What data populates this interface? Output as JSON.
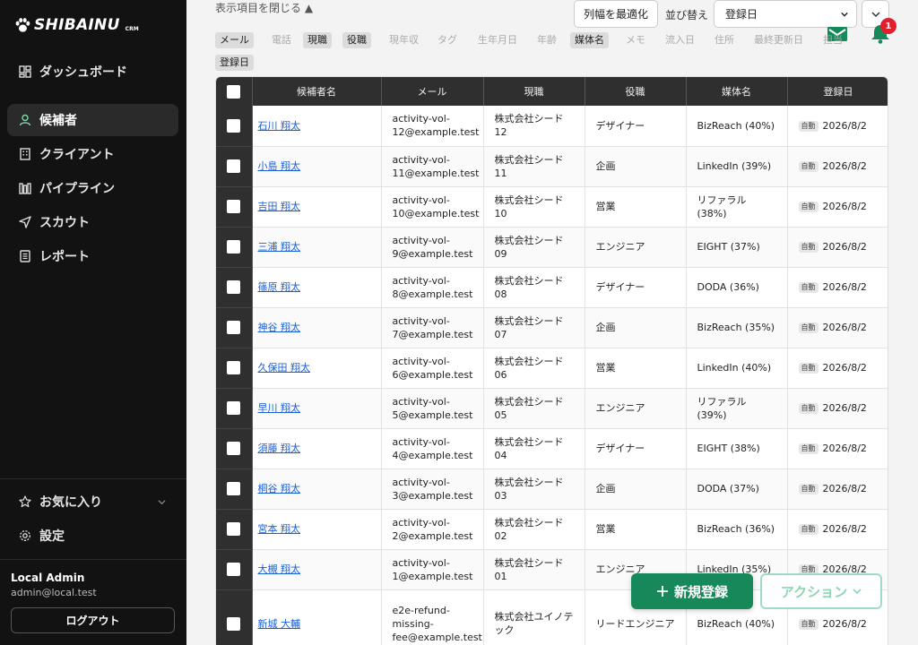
{
  "brand": {
    "name": "SHIBAINU",
    "sub": "CRM"
  },
  "sidebar": {
    "items": [
      {
        "label": "ダッシュボード",
        "icon": "dashboard-icon"
      },
      {
        "label": "候補者",
        "icon": "person-icon",
        "active": true
      },
      {
        "label": "クライアント",
        "icon": "building-icon"
      },
      {
        "label": "パイプライン",
        "icon": "pipeline-icon"
      },
      {
        "label": "スカウト",
        "icon": "send-icon"
      },
      {
        "label": "レポート",
        "icon": "report-icon"
      }
    ],
    "favorites_label": "お気に入り",
    "settings_label": "設定",
    "user": {
      "name": "Local Admin",
      "email": "admin@local.test"
    },
    "logout_label": "ログアウト"
  },
  "toolbar": {
    "collapse_label": "表示項目を閉じる ▲",
    "fit_columns_label": "列幅を最適化",
    "sort_label": "並び替え",
    "sort_value": "登録日",
    "notification_count": "1"
  },
  "column_chips": [
    {
      "label": "メール",
      "on": true
    },
    {
      "label": "電話",
      "on": false
    },
    {
      "label": "現職",
      "on": true
    },
    {
      "label": "役職",
      "on": true
    },
    {
      "label": "現年収",
      "on": false
    },
    {
      "label": "タグ",
      "on": false
    },
    {
      "label": "生年月日",
      "on": false
    },
    {
      "label": "年齢",
      "on": false
    },
    {
      "label": "媒体名",
      "on": true
    },
    {
      "label": "メモ",
      "on": false
    },
    {
      "label": "流入日",
      "on": false
    },
    {
      "label": "住所",
      "on": false
    },
    {
      "label": "最終更新日",
      "on": false
    },
    {
      "label": "担当",
      "on": false
    },
    {
      "label": "登録日",
      "on": true
    }
  ],
  "table": {
    "headers": [
      "候補者名",
      "メール",
      "現職",
      "役職",
      "媒体名",
      "登録日"
    ],
    "auto_label": "自動",
    "rows": [
      {
        "name": "石川 翔太",
        "email": "activity-vol-12@example.test",
        "company": "株式会社シード 12",
        "role": "デザイナー",
        "source": "BizReach (40%)",
        "date": "2026/8/2"
      },
      {
        "name": "小島 翔太",
        "email": "activity-vol-11@example.test",
        "company": "株式会社シード 11",
        "role": "企画",
        "source": "LinkedIn (39%)",
        "date": "2026/8/2"
      },
      {
        "name": "吉田 翔太",
        "email": "activity-vol-10@example.test",
        "company": "株式会社シード 10",
        "role": "営業",
        "source": "リファラル (38%)",
        "date": "2026/8/2"
      },
      {
        "name": "三浦 翔太",
        "email": "activity-vol-9@example.test",
        "company": "株式会社シード 09",
        "role": "エンジニア",
        "source": "EIGHT (37%)",
        "date": "2026/8/2"
      },
      {
        "name": "篠原 翔太",
        "email": "activity-vol-8@example.test",
        "company": "株式会社シード 08",
        "role": "デザイナー",
        "source": "DODA (36%)",
        "date": "2026/8/2"
      },
      {
        "name": "神谷 翔太",
        "email": "activity-vol-7@example.test",
        "company": "株式会社シード 07",
        "role": "企画",
        "source": "BizReach (35%)",
        "date": "2026/8/2"
      },
      {
        "name": "久保田 翔太",
        "email": "activity-vol-6@example.test",
        "company": "株式会社シード 06",
        "role": "営業",
        "source": "LinkedIn (40%)",
        "date": "2026/8/2"
      },
      {
        "name": "早川 翔太",
        "email": "activity-vol-5@example.test",
        "company": "株式会社シード 05",
        "role": "エンジニア",
        "source": "リファラル (39%)",
        "date": "2026/8/2"
      },
      {
        "name": "須藤 翔太",
        "email": "activity-vol-4@example.test",
        "company": "株式会社シード 04",
        "role": "デザイナー",
        "source": "EIGHT (38%)",
        "date": "2026/8/2"
      },
      {
        "name": "桐谷 翔太",
        "email": "activity-vol-3@example.test",
        "company": "株式会社シード 03",
        "role": "企画",
        "source": "DODA (37%)",
        "date": "2026/8/2"
      },
      {
        "name": "宮本 翔太",
        "email": "activity-vol-2@example.test",
        "company": "株式会社シード 02",
        "role": "営業",
        "source": "BizReach (36%)",
        "date": "2026/8/2"
      },
      {
        "name": "大槻 翔太",
        "email": "activity-vol-1@example.test",
        "company": "株式会社シード 01",
        "role": "エンジニア",
        "source": "LinkedIn (35%)",
        "date": "2026/8/2"
      },
      {
        "name": "新城 大輔",
        "email": "e2e-refund-missing-fee@example.test",
        "company": "株式会社ユイノテック",
        "role": "リードエンジニア",
        "source": "BizReach (40%)",
        "date": "2026/8/2"
      }
    ]
  },
  "actions": {
    "new_label": "新規登録",
    "action_label": "アクション"
  },
  "colors": {
    "sidebar_bg": "#121212",
    "primary_green": "#16885a",
    "header_dark": "#2f2f2f",
    "link_blue": "#1a5fd6",
    "badge_red": "#e0202e"
  }
}
